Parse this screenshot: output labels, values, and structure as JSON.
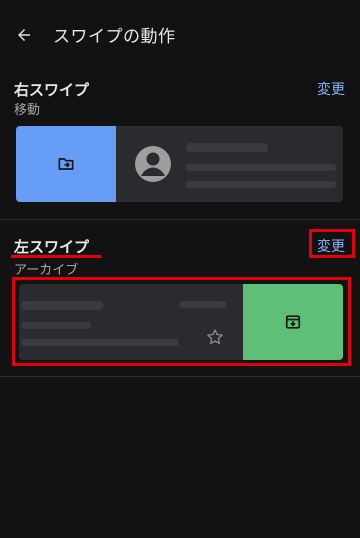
{
  "appbar": {
    "title": "スワイプの動作",
    "back_icon": "arrow-back-icon"
  },
  "right_swipe": {
    "title": "右スワイプ",
    "action": "移動",
    "change_label": "変更",
    "action_color": "#669df6",
    "action_icon": "move-to-folder-icon"
  },
  "left_swipe": {
    "title": "左スワイプ",
    "action": "アーカイブ",
    "change_label": "変更",
    "action_color": "#5fbf77",
    "action_icon": "archive-icon"
  },
  "colors": {
    "background": "#121212",
    "accent_link": "#8ab4f8",
    "annotation_red": "#e3000b"
  }
}
